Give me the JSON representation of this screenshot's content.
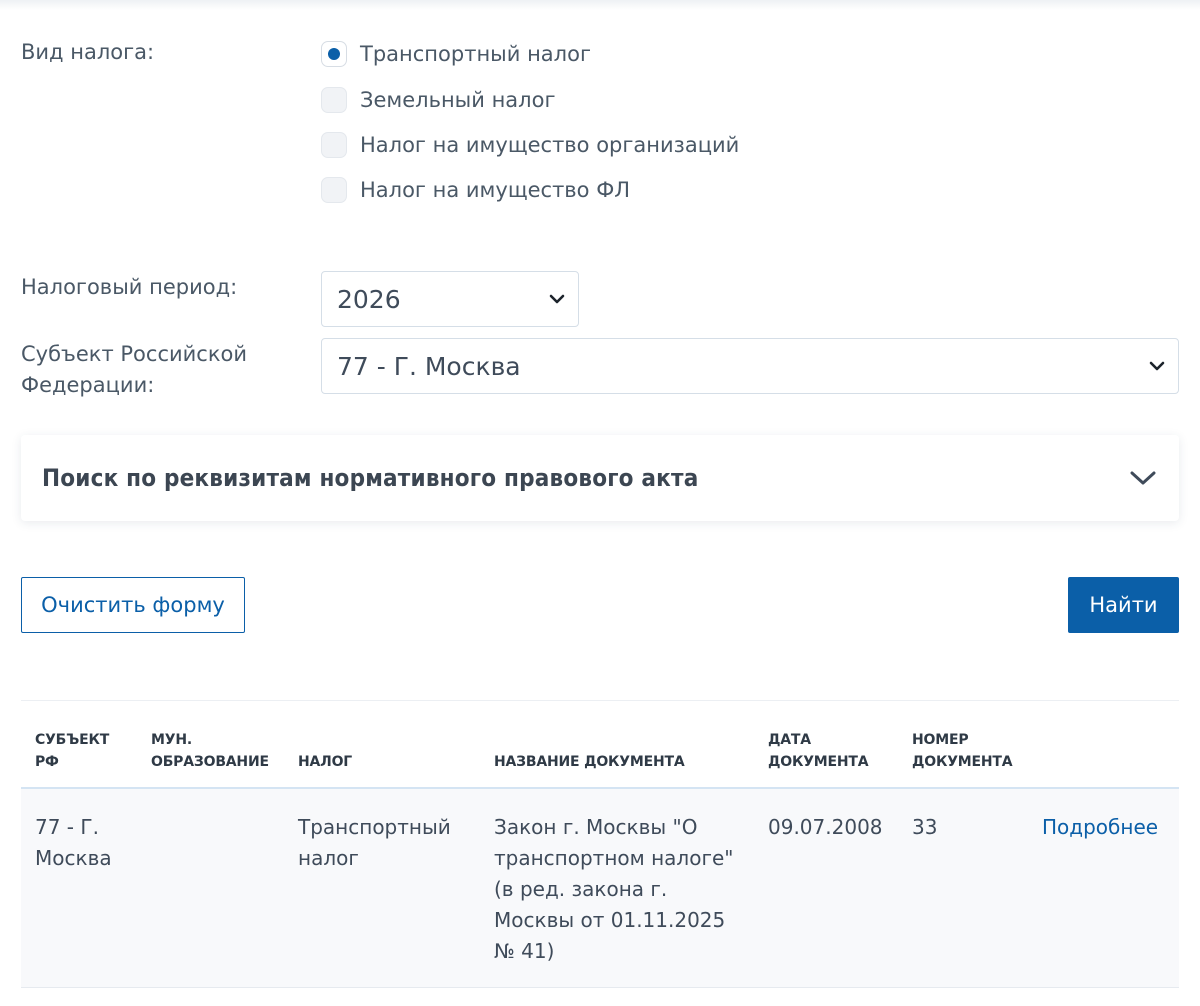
{
  "form": {
    "tax_type_label": "Вид налога:",
    "tax_types": [
      {
        "label": "Транспортный налог",
        "checked": true
      },
      {
        "label": "Земельный налог",
        "checked": false
      },
      {
        "label": "Налог на имущество организаций",
        "checked": false
      },
      {
        "label": "Налог на имущество ФЛ",
        "checked": false
      }
    ],
    "period_label": "Налоговый период:",
    "period_value": "2026",
    "subject_label": "Субъект Российской Федерации:",
    "subject_value": "77 - Г. Москва"
  },
  "accordion": {
    "title": "Поиск по реквизитам нормативного правового акта",
    "icon": "chevron-down-icon"
  },
  "actions": {
    "clear_label": "Очистить форму",
    "search_label": "Найти"
  },
  "table": {
    "headers": [
      "Субъект РФ",
      "Мун. образование",
      "Налог",
      "Название документа",
      "Дата документа",
      "Номер документа",
      ""
    ],
    "rows": [
      {
        "subject": "77 - Г. Москва",
        "municipality": "",
        "tax": "Транспортный налог",
        "document_name": "Закон г. Москвы \"О транспортном налоге\" (в ред. закона г. Москвы от 01.11.2025 № 41)",
        "document_date": "09.07.2008",
        "document_number": "33",
        "details_label": "Подробнее"
      }
    ]
  },
  "colors": {
    "accent": "#0b5fa8",
    "text": "#3f4b5a",
    "border": "#d5dee7"
  }
}
